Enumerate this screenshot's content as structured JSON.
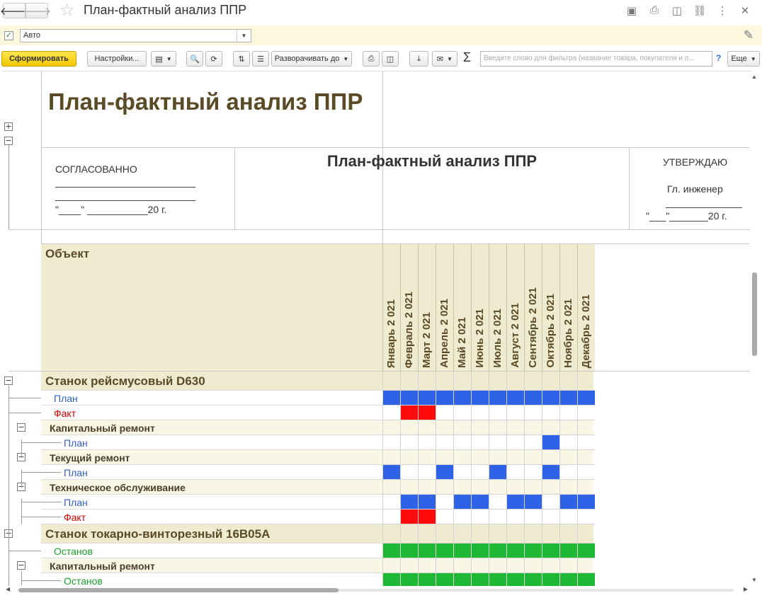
{
  "window": {
    "title": "План-фактный анализ ППР"
  },
  "variant": {
    "value": "Авто"
  },
  "toolbar": {
    "generate": "Сформировать",
    "settings": "Настройки...",
    "expand_to": "Разворачивать до",
    "search_placeholder": "Введите слово для фильтра (название товара, покупателя и п...",
    "help": "?",
    "more": "Еще"
  },
  "report": {
    "title": "План-фактный анализ ППР",
    "center_title": "План-фактный анализ ППР",
    "agreed": "СОГЛАСОВАННО",
    "date_left": "\"____\" ___________20   г.",
    "approve": "УТВЕРЖДАЮ",
    "engineer": "Гл. инженер",
    "date_right": "\"___\"_______20    г.",
    "column_object": "Объект",
    "months": [
      "Январь 2 021",
      "Февраль 2 021",
      "Март 2 021",
      "Апрель 2 021",
      "Май 2 021",
      "Июнь 2 021",
      "Июль 2 021",
      "Август 2 021",
      "Сентябрь 2 021",
      "Октябрь 2 021",
      "Ноябрь 2 021",
      "Декабрь 2 021"
    ],
    "rows": [
      {
        "kind": "obj",
        "label": "Станок рейсмусовый D630",
        "cells": []
      },
      {
        "kind": "plan",
        "label": "План",
        "cells": [
          "blue",
          "blue",
          "blue",
          "blue",
          "blue",
          "blue",
          "blue",
          "blue",
          "blue",
          "blue",
          "blue",
          "blue"
        ]
      },
      {
        "kind": "fact",
        "label": "Факт",
        "cells": [
          "",
          "red",
          "red",
          "",
          "",
          "",
          "",
          "",
          "",
          "",
          "",
          ""
        ]
      },
      {
        "kind": "sec",
        "label": "Капитальный ремонт",
        "cells": []
      },
      {
        "kind": "plan",
        "label": "План",
        "cells": [
          "",
          "",
          "",
          "",
          "",
          "",
          "",
          "",
          "",
          "blue",
          "",
          ""
        ]
      },
      {
        "kind": "sec",
        "label": "Текущий ремонт",
        "cells": []
      },
      {
        "kind": "plan",
        "label": "План",
        "cells": [
          "blue",
          "",
          "",
          "blue",
          "",
          "",
          "blue",
          "",
          "",
          "blue",
          "",
          ""
        ]
      },
      {
        "kind": "sec",
        "label": "Техническое обслуживание",
        "cells": []
      },
      {
        "kind": "plan",
        "label": "План",
        "cells": [
          "",
          "blue",
          "blue",
          "",
          "blue",
          "blue",
          "",
          "blue",
          "blue",
          "",
          "blue",
          "blue"
        ]
      },
      {
        "kind": "fact",
        "label": "Факт",
        "cells": [
          "",
          "red",
          "red",
          "",
          "",
          "",
          "",
          "",
          "",
          "",
          "",
          ""
        ]
      },
      {
        "kind": "obj",
        "label": "Станок токарно-винторезный 16В05А",
        "cells": []
      },
      {
        "kind": "stop",
        "label": "Останов",
        "cells": [
          "green",
          "green",
          "green",
          "green",
          "green",
          "green",
          "green",
          "green",
          "green",
          "green",
          "green",
          "green"
        ]
      },
      {
        "kind": "sec",
        "label": "Капитальный ремонт",
        "cells": []
      },
      {
        "kind": "stop",
        "label": "Останов",
        "cells": [
          "green",
          "green",
          "green",
          "green",
          "green",
          "green",
          "green",
          "green",
          "green",
          "green",
          "green",
          "green"
        ]
      }
    ]
  },
  "colors": {
    "blue": "#2e63e8",
    "red": "#ff0a0a",
    "green": "#1eb835",
    "obj_bg": "#efebd0",
    "sec_bg": "#faf6e6"
  }
}
